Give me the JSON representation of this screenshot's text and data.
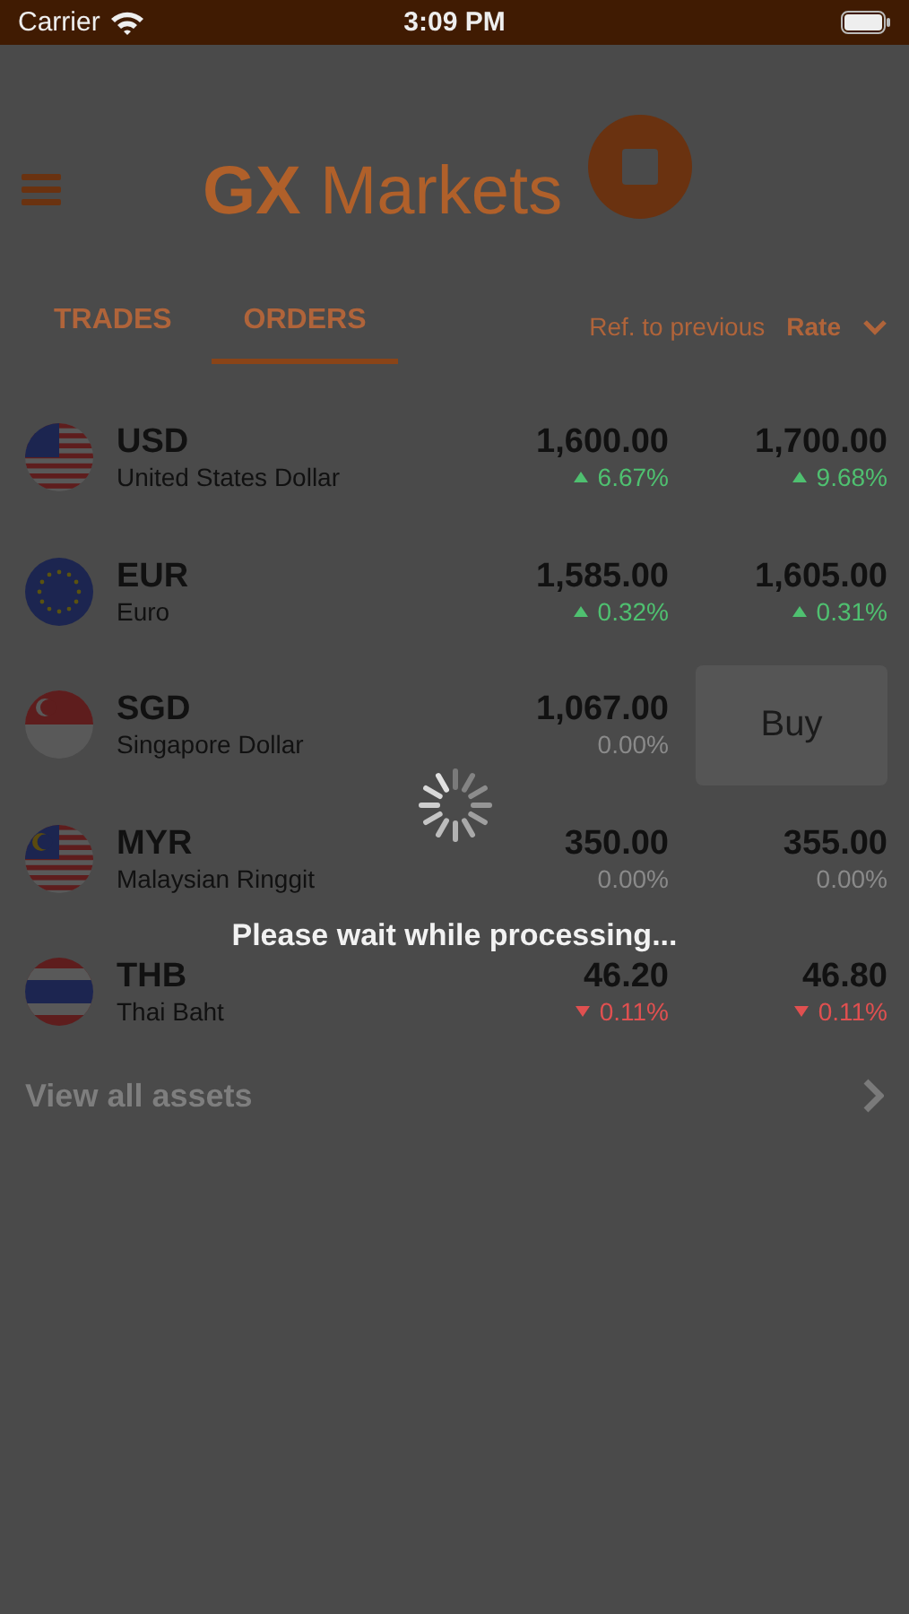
{
  "status_bar": {
    "carrier": "Carrier",
    "time": "3:09 PM"
  },
  "header": {
    "title_bold": "GX",
    "title_rest": "Markets"
  },
  "tabs": [
    {
      "label": "TRADES",
      "selected": false
    },
    {
      "label": "ORDERS",
      "selected": true
    }
  ],
  "reference": {
    "label": "Ref. to previous",
    "sort": "Rate"
  },
  "assets": [
    {
      "code": "USD",
      "name": "United States Dollar",
      "flag": {
        "kind": "us"
      },
      "bid": {
        "value": "1,600.00",
        "change": "6.67%",
        "kind": "up"
      },
      "ask": {
        "value": "1,700.00",
        "change": "9.68%",
        "kind": "up"
      }
    },
    {
      "code": "EUR",
      "name": "Euro",
      "flag": {
        "kind": "eu"
      },
      "bid": {
        "value": "1,585.00",
        "change": "0.32%",
        "kind": "up"
      },
      "ask": {
        "value": "1,605.00",
        "change": "0.31%",
        "kind": "up"
      }
    },
    {
      "code": "SGD",
      "name": "Singapore Dollar",
      "flag": {
        "kind": "sg"
      },
      "bid": {
        "value": "1,067.00",
        "change": "0.00%",
        "kind": "flat"
      },
      "button": "Buy"
    },
    {
      "code": "MYR",
      "name": "Malaysian Ringgit",
      "flag": {
        "kind": "my"
      },
      "bid": {
        "value": "350.00",
        "change": "0.00%",
        "kind": "flat"
      },
      "ask": {
        "value": "355.00",
        "change": "0.00%",
        "kind": "flat"
      }
    },
    {
      "code": "THB",
      "name": "Thai Baht",
      "flag": {
        "kind": "th"
      },
      "bid": {
        "value": "46.20",
        "change": "0.11%",
        "kind": "down"
      },
      "ask": {
        "value": "46.80",
        "change": "0.11%",
        "kind": "down"
      }
    }
  ],
  "view_all": "View all assets",
  "loader": {
    "message": "Please wait while processing..."
  }
}
